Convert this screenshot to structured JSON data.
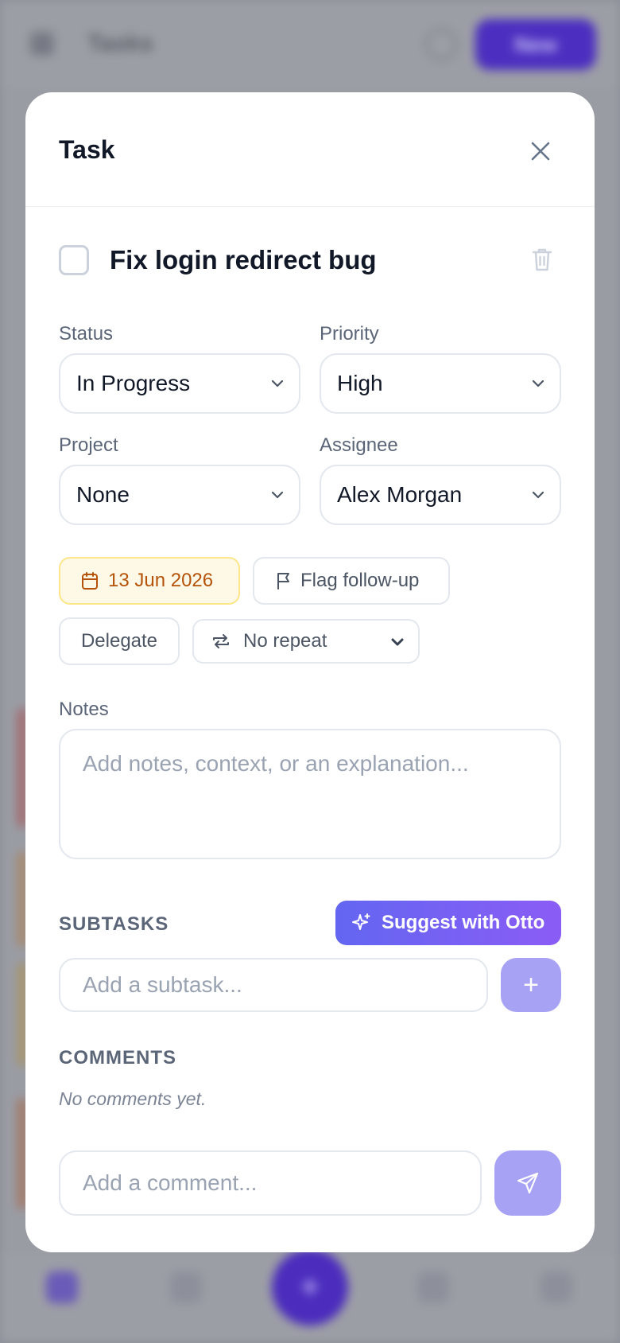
{
  "background_app": {
    "title": "Tasks",
    "new_button": "New"
  },
  "modal": {
    "title": "Task",
    "task": {
      "name": "Fix login redirect bug",
      "completed": false
    },
    "status": {
      "label": "Status",
      "value": "In Progress"
    },
    "priority": {
      "label": "Priority",
      "value": "High"
    },
    "project": {
      "label": "Project",
      "value": "None"
    },
    "assignee": {
      "label": "Assignee",
      "value": "Alex Morgan"
    },
    "due_date": "13 Jun 2026",
    "flag_label": "Flag follow-up",
    "delegate_label": "Delegate",
    "repeat_value": "No repeat",
    "notes": {
      "label": "Notes",
      "placeholder": "Add notes, context, or an explanation..."
    },
    "subtasks": {
      "title": "SUBTASKS",
      "suggest_label": "Suggest with Otto",
      "placeholder": "Add a subtask...",
      "add_symbol": "+"
    },
    "comments": {
      "title": "COMMENTS",
      "empty_text": "No comments yet.",
      "placeholder": "Add a comment..."
    }
  },
  "colors": {
    "accent": "#6366f1",
    "accent_light": "#a7a2f4",
    "date_text": "#b45309",
    "date_bg": "#fef9e6"
  }
}
